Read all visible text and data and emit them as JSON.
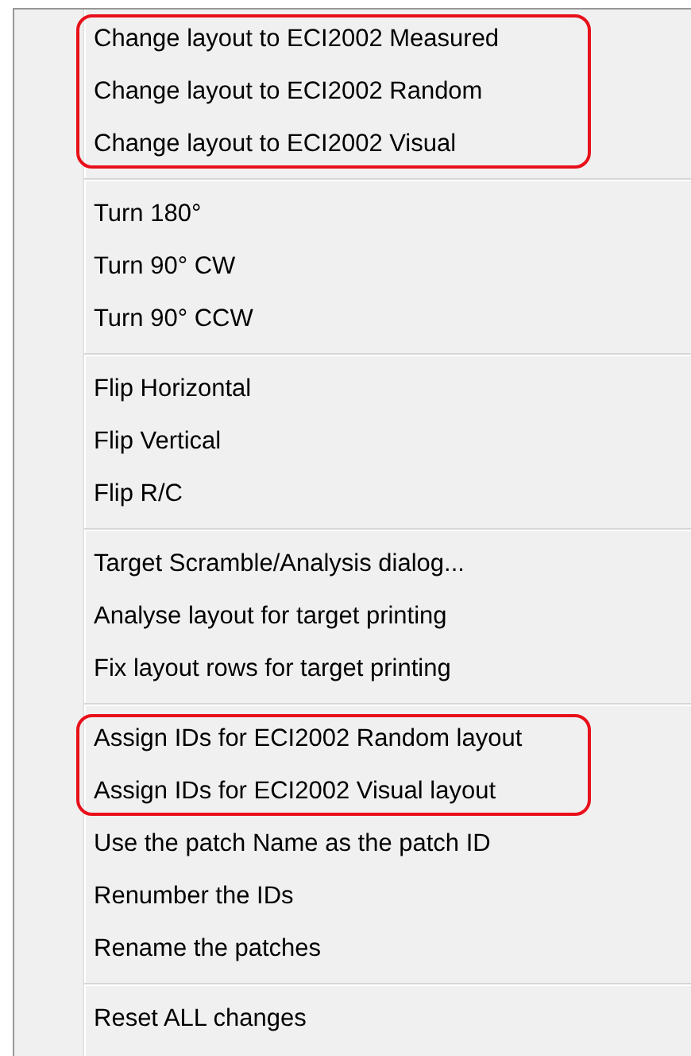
{
  "sections": [
    {
      "groups": [
        {
          "highlighted": true,
          "items": [
            "Change layout to ECI2002 Measured",
            "Change layout to ECI2002 Random",
            "Change layout to ECI2002 Visual"
          ]
        }
      ]
    },
    {
      "groups": [
        {
          "highlighted": false,
          "items": [
            "Turn 180°",
            "Turn 90° CW",
            "Turn 90° CCW"
          ]
        }
      ]
    },
    {
      "groups": [
        {
          "highlighted": false,
          "items": [
            "Flip Horizontal",
            "Flip Vertical",
            "Flip R/C"
          ]
        }
      ]
    },
    {
      "groups": [
        {
          "highlighted": false,
          "items": [
            "Target Scramble/Analysis dialog...",
            "Analyse layout for target printing",
            "Fix layout rows for target printing"
          ]
        }
      ]
    },
    {
      "groups": [
        {
          "highlighted": true,
          "items": [
            "Assign IDs for ECI2002 Random layout",
            "Assign IDs for ECI2002 Visual layout"
          ]
        },
        {
          "highlighted": false,
          "items": [
            "Use the patch Name as the patch ID",
            "Renumber the IDs",
            "Rename the patches"
          ]
        }
      ]
    },
    {
      "groups": [
        {
          "highlighted": false,
          "items": [
            "Reset ALL changes"
          ]
        }
      ]
    }
  ]
}
